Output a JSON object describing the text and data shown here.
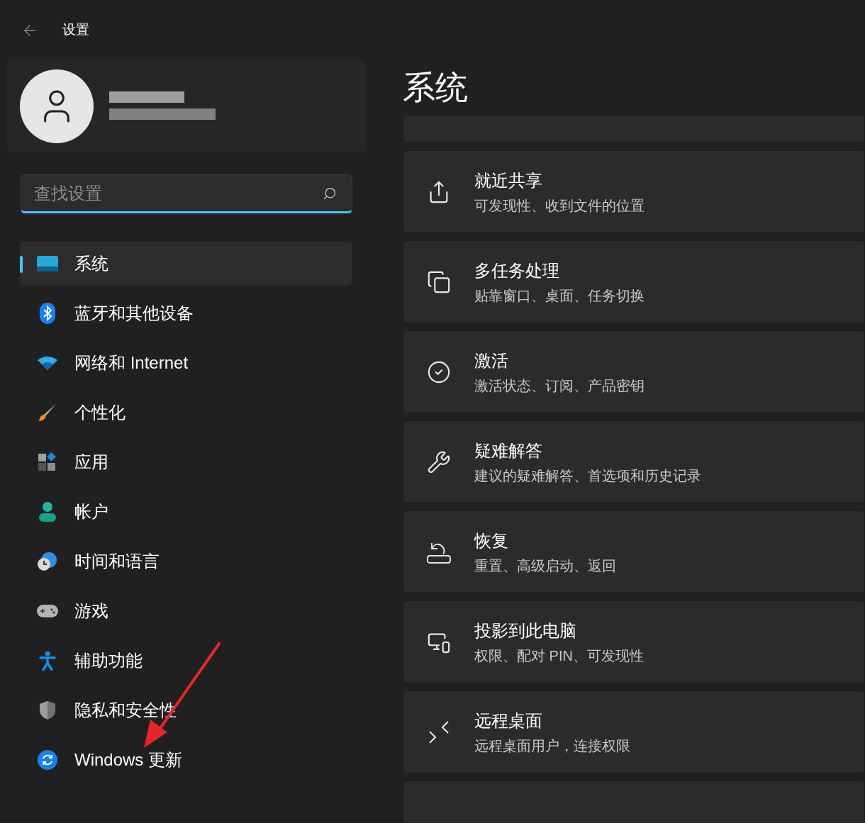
{
  "window": {
    "title": "设置"
  },
  "search": {
    "placeholder": "查找设置",
    "focused": true
  },
  "nav": [
    {
      "label": "系统",
      "selected": true
    },
    {
      "label": "蓝牙和其他设备",
      "selected": false
    },
    {
      "label": "网络和 Internet",
      "selected": false
    },
    {
      "label": "个性化",
      "selected": false
    },
    {
      "label": "应用",
      "selected": false
    },
    {
      "label": "帐户",
      "selected": false
    },
    {
      "label": "时间和语言",
      "selected": false
    },
    {
      "label": "游戏",
      "selected": false
    },
    {
      "label": "辅助功能",
      "selected": false
    },
    {
      "label": "隐私和安全性",
      "selected": false
    },
    {
      "label": "Windows 更新",
      "selected": false
    }
  ],
  "page": {
    "title": "系统"
  },
  "cards": [
    {
      "title": "就近共享",
      "subtitle": "可发现性、收到文件的位置"
    },
    {
      "title": "多任务处理",
      "subtitle": "贴靠窗口、桌面、任务切换"
    },
    {
      "title": "激活",
      "subtitle": "激活状态、订阅、产品密钥"
    },
    {
      "title": "疑难解答",
      "subtitle": "建议的疑难解答、首选项和历史记录"
    },
    {
      "title": "恢复",
      "subtitle": "重置、高级启动、返回"
    },
    {
      "title": "投影到此电脑",
      "subtitle": "权限、配对 PIN、可发现性"
    },
    {
      "title": "远程桌面",
      "subtitle": "远程桌面用户，连接权限"
    }
  ]
}
